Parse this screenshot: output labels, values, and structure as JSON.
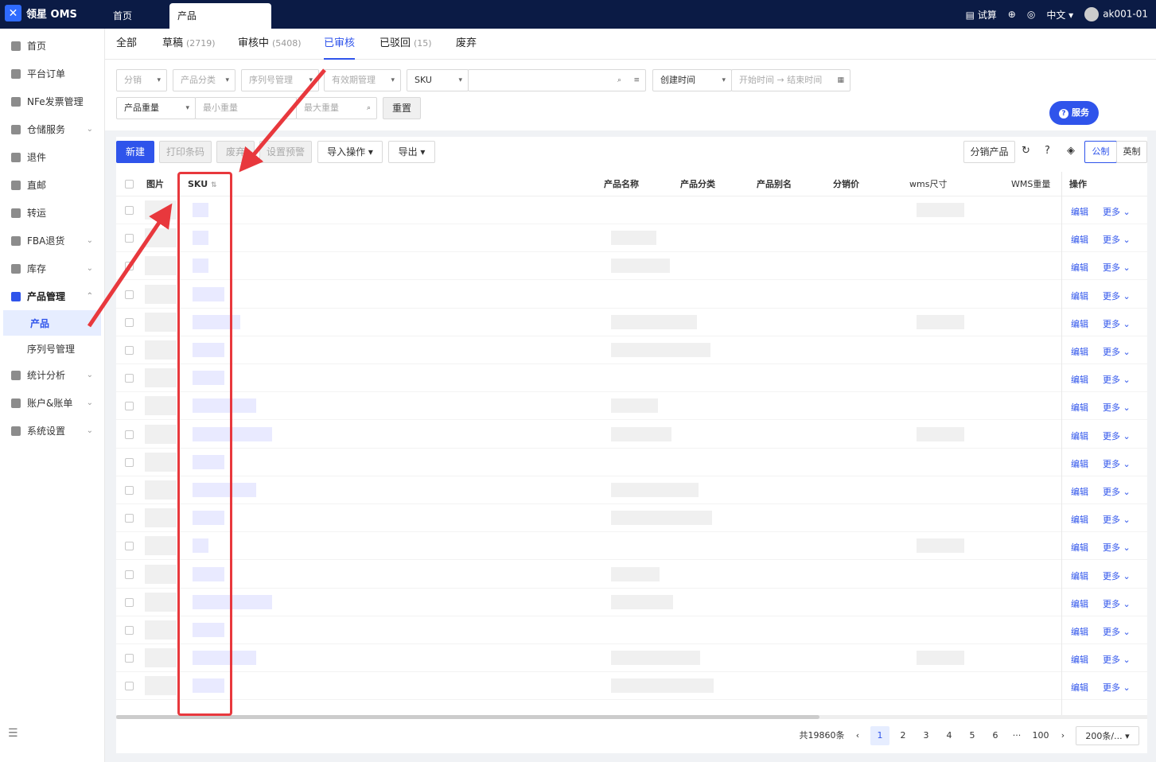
{
  "app": {
    "title": "领星 OMS"
  },
  "top_tabs": {
    "home": "首页",
    "active": "产品"
  },
  "top_right": {
    "trial": "试算",
    "language": "中文",
    "user": "ak001-01"
  },
  "sidebar": {
    "items": [
      {
        "label": "首页"
      },
      {
        "label": "平台订单"
      },
      {
        "label": "NFe发票管理"
      },
      {
        "label": "仓储服务"
      },
      {
        "label": "退件"
      },
      {
        "label": "直邮"
      },
      {
        "label": "转运"
      },
      {
        "label": "FBA退货"
      },
      {
        "label": "库存"
      },
      {
        "label": "产品管理"
      },
      {
        "label": "统计分析"
      },
      {
        "label": "账户&账单"
      },
      {
        "label": "系统设置"
      }
    ],
    "sub_items": [
      {
        "label": "产品"
      },
      {
        "label": "序列号管理"
      }
    ]
  },
  "sub_tabs": [
    {
      "label": "全部",
      "count": ""
    },
    {
      "label": "草稿",
      "count": "(2719)"
    },
    {
      "label": "审核中",
      "count": "(5408)"
    },
    {
      "label": "已审核",
      "count": ""
    },
    {
      "label": "已驳回",
      "count": "(15)"
    },
    {
      "label": "废弃",
      "count": ""
    }
  ],
  "filters": {
    "distribution": "分销",
    "category": "产品分类",
    "serial": "序列号管理",
    "expiry": "有效期管理",
    "sku_type": "SKU",
    "time_type": "创建时间",
    "start_time": "开始时间",
    "end_time": "结束时间",
    "weight": "产品重量",
    "min_weight": "最小重量",
    "max_weight": "最大重量",
    "reset": "重置",
    "service": "服务"
  },
  "toolbar": {
    "new": "新建",
    "print_barcode": "打印条码",
    "discard": "废弃",
    "set_alert": "设置预警",
    "import": "导入操作",
    "export": "导出",
    "distribute": "分销产品",
    "metric": "公制",
    "imperial": "英制"
  },
  "table": {
    "headers": {
      "image": "图片",
      "sku": "SKU",
      "name": "产品名称",
      "category": "产品分类",
      "alias": "产品别名",
      "price": "分销价",
      "wms_size": "wms尺寸",
      "wms_weight": "WMS重量",
      "ops": "操作"
    },
    "row_count": 18,
    "edit_label": "编辑",
    "more_label": "更多"
  },
  "pagination": {
    "total": "共19860条",
    "pages": [
      "1",
      "2",
      "3",
      "4",
      "5",
      "6",
      "···",
      "100"
    ],
    "current": "1",
    "page_size": "200条/..."
  },
  "colors": {
    "brand": "#2f54eb",
    "topbar": "#0b1b45",
    "annotation": "#e8383d"
  }
}
